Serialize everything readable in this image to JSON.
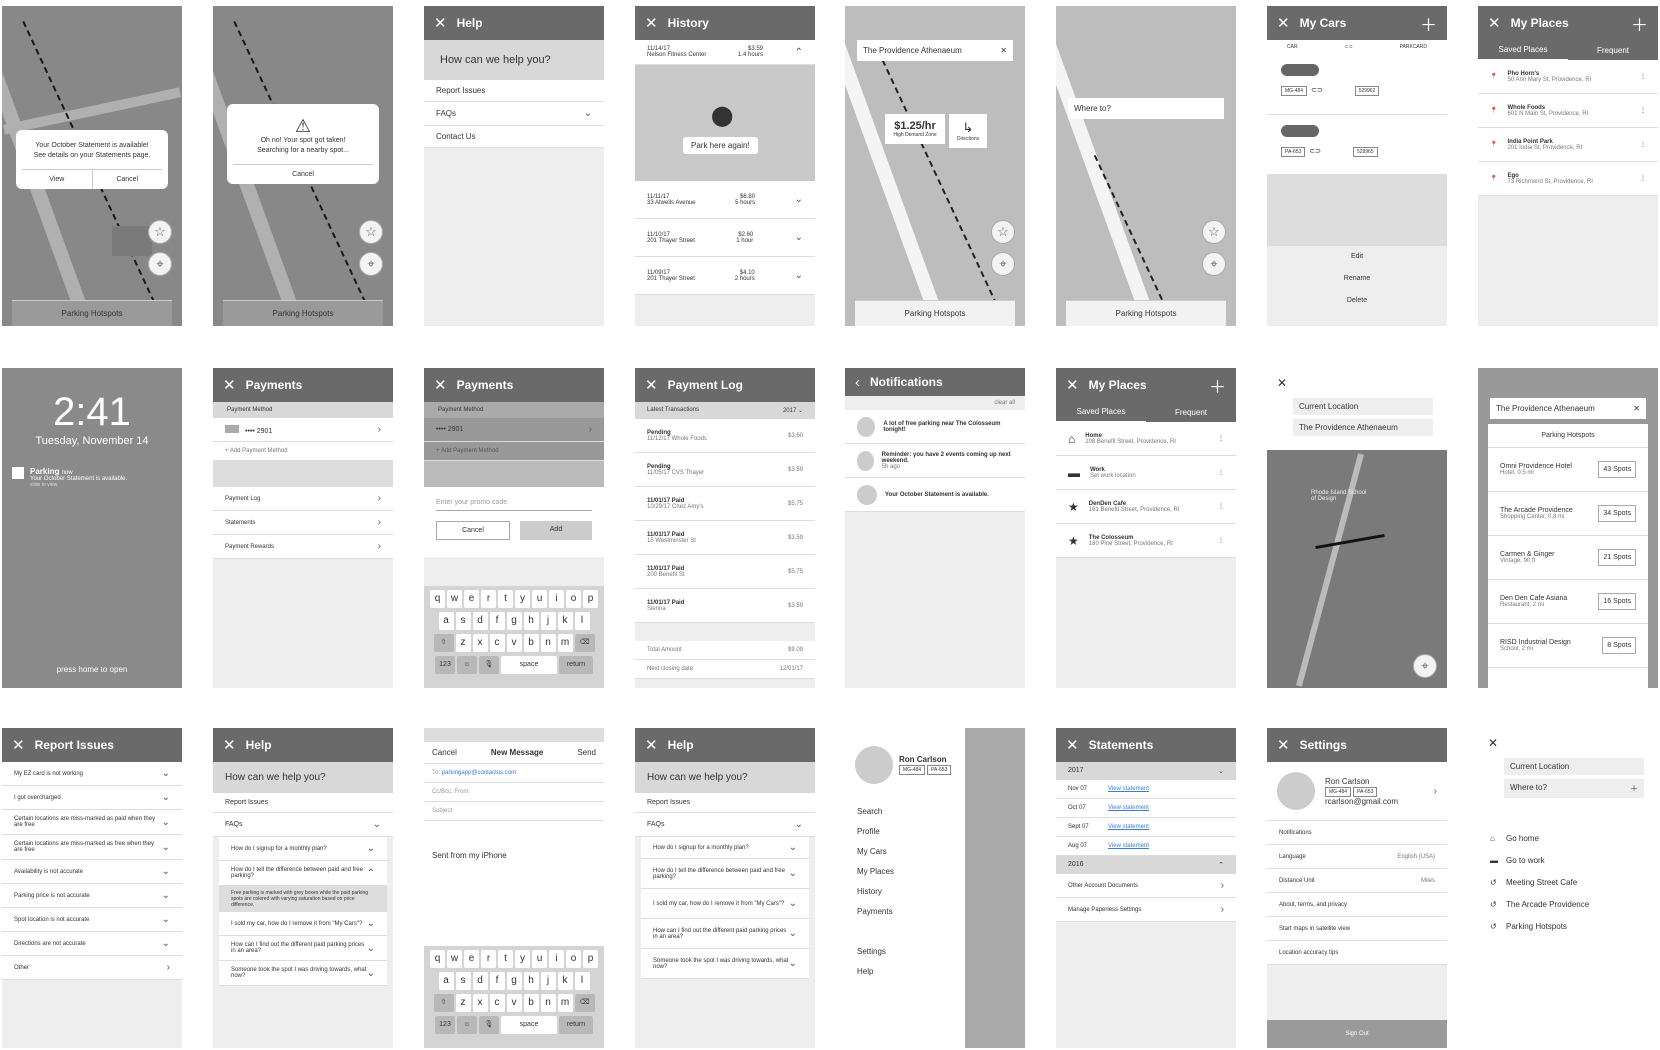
{
  "home_dialog": {
    "title": "Your October Statement is available!",
    "body": "See details on your Statements page.",
    "view": "View",
    "cancel": "Cancel",
    "bottom": "Parking Hotspots"
  },
  "taken_dialog": {
    "title": "Oh no! Your spot got taken!",
    "body": "Searching for a nearby spot...",
    "cancel": "Cancel",
    "bottom": "Parking Hotspots"
  },
  "help1": {
    "title": "Help",
    "question": "How can we help you?",
    "items": [
      "Report Issues",
      "FAQs",
      "Contact Us"
    ]
  },
  "history": {
    "title": "History",
    "park_again": "Park here again!",
    "entries": [
      {
        "date": "11/14/17",
        "place": "Nelson Fitness Center",
        "price": "$3.59",
        "dur": "1.4 hours"
      },
      {
        "date": "11/11/17",
        "place": "33 Atwells Avenue",
        "price": "$6.80",
        "dur": "5 hours"
      },
      {
        "date": "11/10/17",
        "place": "201 Thayer Street",
        "price": "$2.60",
        "dur": "1 hour"
      },
      {
        "date": "11/09/17",
        "place": "201 Thayer Street",
        "price": "$4.10",
        "dur": "2 hours"
      }
    ]
  },
  "rate": {
    "search": "The Providence Athenaeum",
    "price": "$1.25/hr",
    "zone": "High Demand Zone",
    "directions": "Directions",
    "bottom": "Parking Hotspots"
  },
  "whereto": {
    "placeholder": "Where to?",
    "bottom": "Parking Hotspots"
  },
  "mycars": {
    "title": "My Cars",
    "car_label": "CAR",
    "pass_label": "PARKCARD",
    "cars": [
      {
        "plate": "MG-484",
        "card": "529962"
      },
      {
        "plate": "PA-653",
        "card": "529965"
      }
    ],
    "actions": [
      "Edit",
      "Rename",
      "Delete"
    ]
  },
  "myplaces": {
    "title": "My Places",
    "tab1": "Saved Places",
    "tab2": "Frequent",
    "items": [
      {
        "name": "Pho Horn's",
        "addr": "50 Ann Mary St, Providence, RI"
      },
      {
        "name": "Whole Foods",
        "addr": "601 N Main St, Providence, RI"
      },
      {
        "name": "India Point Park",
        "addr": "201 India St, Providence, RI"
      },
      {
        "name": "Ego",
        "addr": "73 Richmond St, Providence, RI"
      }
    ]
  },
  "lock": {
    "time": "2:41",
    "date": "Tuesday, November 14",
    "app": "Parking",
    "ago": "now",
    "msg": "Your October Statement is available.",
    "sub": "slide to view",
    "footer": "press home to open"
  },
  "payments": {
    "title": "Payments",
    "section": "Payment Method",
    "card": "•••• 2901",
    "add": "+ Add Payment Method",
    "links": [
      "Payment Log",
      "Statements",
      "Payment Rewards"
    ]
  },
  "promo": {
    "title": "Payments",
    "section": "Payment Method",
    "card": "•••• 2901",
    "add": "+ Add Payment Method",
    "placeholder": "Enter your promo code",
    "cancel": "Cancel",
    "add_btn": "Add"
  },
  "keyboard": {
    "row1": [
      "q",
      "w",
      "e",
      "r",
      "t",
      "y",
      "u",
      "i",
      "o",
      "p"
    ],
    "row2": [
      "a",
      "s",
      "d",
      "f",
      "g",
      "h",
      "j",
      "k",
      "l"
    ],
    "row3": [
      "z",
      "x",
      "c",
      "v",
      "b",
      "n",
      "m"
    ],
    "num": "123",
    "space": "space",
    "ret": "return"
  },
  "paylog": {
    "title": "Payment Log",
    "latest": "Latest Transactions",
    "year": "2017",
    "tx": [
      {
        "h": "Pending",
        "s": "11/12/17 Whole Foods",
        "a": "$3.60"
      },
      {
        "h": "Pending",
        "s": "11/05/17 CVS Thayer",
        "a": "$3.59"
      },
      {
        "h": "11/01/17 Paid",
        "s": "10/29/17 Chez Amy's",
        "a": "$5.75"
      },
      {
        "h": "11/01/17 Paid",
        "s": "15 Westminster St",
        "a": "$3.59"
      },
      {
        "h": "11/01/17 Paid",
        "s": "200 Benefit St",
        "a": "$5.75"
      },
      {
        "h": "11/01/17 Paid",
        "s": "Sienna",
        "a": "$3.59"
      }
    ],
    "total_label": "Total Amount",
    "total": "$9.09",
    "next_label": "Next closing date",
    "next": "12/01/17"
  },
  "notif": {
    "title": "Notifications",
    "clear": "clear all",
    "items": [
      {
        "t": "A lot of free parking near The Colosseum tonight!",
        "s": ""
      },
      {
        "t": "Reminder: you have 2 events coming up next weekend.",
        "s": "5h ago"
      },
      {
        "t": "Your October Statement is available.",
        "s": ""
      }
    ]
  },
  "myplaces2": {
    "title": "My Places",
    "tab1": "Saved Places",
    "tab2": "Frequent",
    "items": [
      {
        "name": "Home",
        "addr": "208 Benefit Street, Providence, RI",
        "icon": "home-icon"
      },
      {
        "name": "Work",
        "addr": "Set work location",
        "icon": "briefcase-icon"
      },
      {
        "name": "DenDen Cafe",
        "addr": "161 Benefit Street, Providence, RI",
        "icon": "star-icon"
      },
      {
        "name": "The Colosseum",
        "addr": "180 Pine Street, Providence, RI",
        "icon": "star-icon"
      }
    ]
  },
  "route": {
    "from": "Current Location",
    "to": "The Providence Athenaeum",
    "label1": "Rhode Island School of Design"
  },
  "hotspots": {
    "search": "The Providence Athenaeum",
    "title": "Parking Hotspots",
    "items": [
      {
        "n": "Omni Providence Hotel",
        "s": "Hotel, 0.5 mi",
        "c": "43 Spots"
      },
      {
        "n": "The Arcade Providence",
        "s": "Shopping Center, 0.8 mi",
        "c": "34 Spots"
      },
      {
        "n": "Carmen & Ginger",
        "s": "Vintage, 90 ft",
        "c": "21 Spots"
      },
      {
        "n": "Den Den Cafe Asiana",
        "s": "Restaurant, 2 mi",
        "c": "16 Spots"
      },
      {
        "n": "RISD Industrial Design",
        "s": "School, 2 mi",
        "c": "8 Spots"
      }
    ]
  },
  "report": {
    "title": "Report Issues",
    "items": [
      "My EZ card is not working",
      "I got overcharged",
      "Certain locations are miss-marked as paid when they are free",
      "Certain locations are miss-marked as free when they are free",
      "Availability is not accurate",
      "Parking price is not accurate",
      "Spot location is not accurate",
      "Directions are not accurate",
      "Other"
    ]
  },
  "help2": {
    "title": "Help",
    "question": "How can we help you?",
    "report": "Report Issues",
    "faqs": "FAQs",
    "q": [
      "How do I signup for a monthly plan?",
      "How do I tell the difference between paid and free parking?",
      "I sold my car, how do I remove it from \"My Cars\"?",
      "How can I find out the different paid parking prices in an area?",
      "Someone took the spot I was driving towards, what now?"
    ],
    "answer": "Free parking is marked with grey boxes while the paid parking spots are colored with varying saturation based on price difference."
  },
  "mail": {
    "cancel": "Cancel",
    "title": "New Message",
    "send": "Send",
    "to_label": "To:",
    "to": "parkingapp@contactus.com",
    "cc": "Cc/Bcc, From:",
    "subject": "Subject:",
    "body": "Sent from my iPhone"
  },
  "help3": {
    "title": "Help",
    "question": "How can we help you?",
    "report": "Report Issues",
    "faqs": "FAQs",
    "q": [
      "How do I signup for a monthly plan?",
      "How do I tell the difference between paid and free parking?",
      "I sold my car, how do I remove it from \"My Cars\"?",
      "How can I find out the different paid parking prices in an area?",
      "Someone took the spot I was driving towards, what now?"
    ]
  },
  "menu": {
    "name": "Ron Carlson",
    "plates": [
      "MG-484",
      "PA-653"
    ],
    "items": [
      "Search",
      "Profile",
      "My Cars",
      "My Places",
      "History",
      "Payments"
    ],
    "items2": [
      "Settings",
      "Help"
    ]
  },
  "statements": {
    "title": "Statements",
    "y1": "2017",
    "rows": [
      {
        "m": "Nov 07",
        "l": "View statement"
      },
      {
        "m": "Oct 07",
        "l": "View statement"
      },
      {
        "m": "Sept 07",
        "l": "View statement"
      },
      {
        "m": "Aug 07",
        "l": "View statement"
      }
    ],
    "y2": "2016",
    "other": [
      "Other Account Documents",
      "Manage Paperless Settings"
    ]
  },
  "settings": {
    "title": "Settings",
    "name": "Ron Carlson",
    "plates": [
      "MG-484",
      "PA-653"
    ],
    "email": "rcarlson@gmail.com",
    "rows": [
      {
        "l": "Notifications",
        "v": ""
      },
      {
        "l": "Language",
        "v": "English (USA)"
      },
      {
        "l": "Distance Unit",
        "v": "Miles"
      },
      {
        "l": "About, terms, and privacy",
        "v": ""
      },
      {
        "l": "Start maps in satellite view",
        "v": ""
      },
      {
        "l": "Location accuracy tips",
        "v": ""
      }
    ],
    "signout": "Sign Out"
  },
  "search2": {
    "from": "Current Location",
    "to": "Where to?",
    "items": [
      {
        "t": "Go home",
        "i": "home-icon"
      },
      {
        "t": "Go to work",
        "i": "briefcase-icon"
      },
      {
        "t": "Meeting Street Cafe",
        "i": "history-icon"
      },
      {
        "t": "The Arcade Providence",
        "i": "history-icon"
      },
      {
        "t": "Parking Hotspots",
        "i": "history-icon"
      }
    ]
  }
}
